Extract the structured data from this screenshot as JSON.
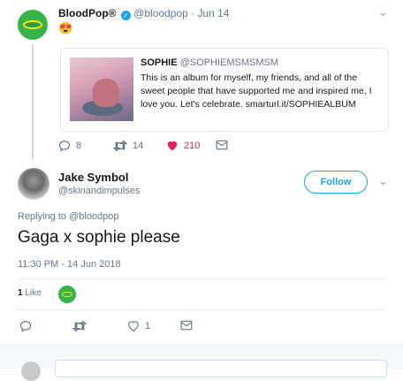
{
  "tweet1": {
    "display_name": "BloodPop®",
    "handle": "@bloodpop",
    "separator": "·",
    "date": "Jun 14",
    "text": "😍",
    "quote": {
      "display_name": "SOPHIE",
      "handle": "@SOPHIEMSMSMSM",
      "text": "This is an album for myself, my friends, and all of the sweet people that have supported me and inspired me, I love you. Let's celebrate. smarturl.it/SOPHIEALBUM"
    },
    "actions": {
      "reply_count": "8",
      "retweet_count": "14",
      "like_count": "210"
    }
  },
  "tweet2": {
    "display_name": "Jake Symbol",
    "handle": "@skinandimpulses",
    "follow_label": "Follow",
    "replying_to": "Replying to @bloodpop",
    "text": "Gaga x sophie please",
    "timestamp": "11:30 PM - 14 Jun 2018",
    "likes_count": "1",
    "likes_label": "Like",
    "actions": {
      "reply_count": "",
      "retweet_count": "",
      "like_count": "1"
    }
  },
  "colors": {
    "accent_blue": "#1da1f2",
    "like_red": "#e0245e",
    "muted": "#657786",
    "avatar_green": "#37b34a",
    "ring_yellow": "#ffe600"
  },
  "icons": [
    "verified-badge-icon",
    "chevron-down-icon",
    "reply-icon",
    "retweet-icon",
    "heart-icon",
    "message-icon"
  ]
}
